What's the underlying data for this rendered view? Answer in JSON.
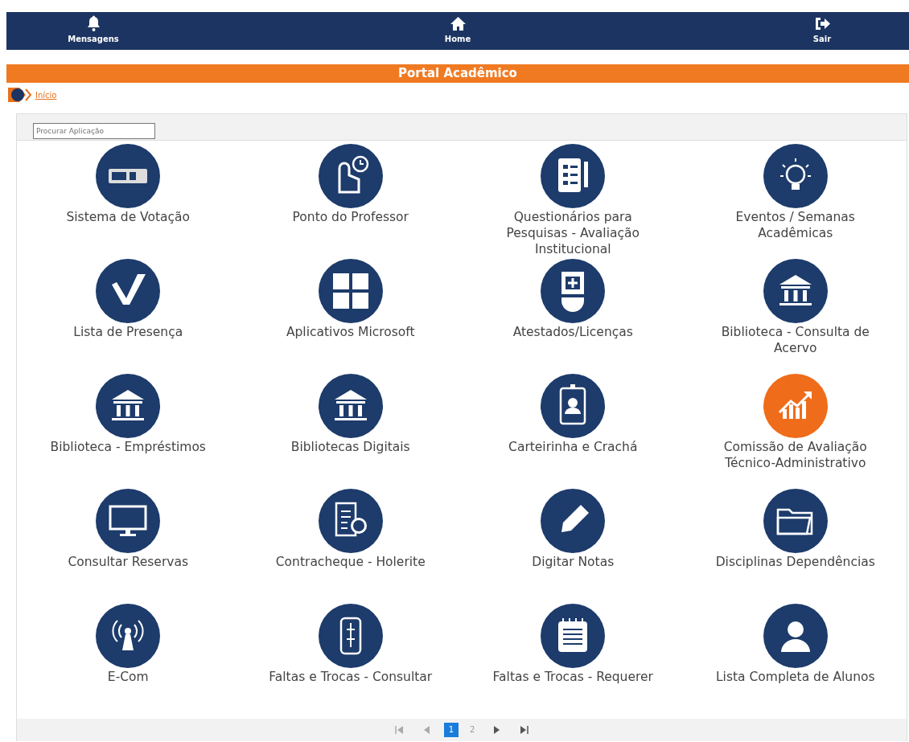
{
  "top_nav": [
    {
      "label": "Mensagens"
    },
    {
      "label": "Home"
    },
    {
      "label": "Sair"
    }
  ],
  "banner": {
    "title": "Portal Acadêmico"
  },
  "breadcrumb": {
    "label": "Início"
  },
  "search": {
    "placeholder": "Procurar Aplicação"
  },
  "apps": [
    {
      "label": "Sistema de Votação",
      "color": "#1d3b6b"
    },
    {
      "label": "Ponto do Professor",
      "color": "#1d3b6b"
    },
    {
      "label": "Questionários para Pesquisas - Avaliação Institucional",
      "color": "#1d3b6b"
    },
    {
      "label": "Eventos / Semanas Acadêmicas",
      "color": "#1d3b6b"
    },
    {
      "label": "Lista de Presença",
      "color": "#1d3b6b"
    },
    {
      "label": "Aplicativos Microsoft",
      "color": "#1d3b6b"
    },
    {
      "label": "Atestados/Licenças",
      "color": "#1d3b6b"
    },
    {
      "label": "Biblioteca - Consulta de Acervo",
      "color": "#1d3b6b"
    },
    {
      "label": "Biblioteca - Empréstimos",
      "color": "#1d3b6b"
    },
    {
      "label": "Bibliotecas Digitais",
      "color": "#1d3b6b"
    },
    {
      "label": "Carteirinha e Crachá",
      "color": "#1d3b6b"
    },
    {
      "label": "Comissão de Avaliação Técnico-Administrativo",
      "color": "#ef6c1a"
    },
    {
      "label": "Consultar Reservas",
      "color": "#1d3b6b"
    },
    {
      "label": "Contracheque - Holerite",
      "color": "#1d3b6b"
    },
    {
      "label": "Digitar Notas",
      "color": "#1d3b6b"
    },
    {
      "label": "Disciplinas Dependências",
      "color": "#1d3b6b"
    },
    {
      "label": "E-Com",
      "color": "#1d3b6b"
    },
    {
      "label": "Faltas e Trocas - Consultar",
      "color": "#1d3b6b"
    },
    {
      "label": "Faltas e Trocas - Requerer",
      "color": "#1d3b6b"
    },
    {
      "label": "Lista Completa de Alunos",
      "color": "#1d3b6b"
    }
  ],
  "pagination": [
    {
      "kind": "first"
    },
    {
      "kind": "prev"
    },
    {
      "kind": "page",
      "label": "1",
      "selected": true
    },
    {
      "kind": "page",
      "label": "2",
      "selected": false
    },
    {
      "kind": "next"
    },
    {
      "kind": "last"
    }
  ]
}
